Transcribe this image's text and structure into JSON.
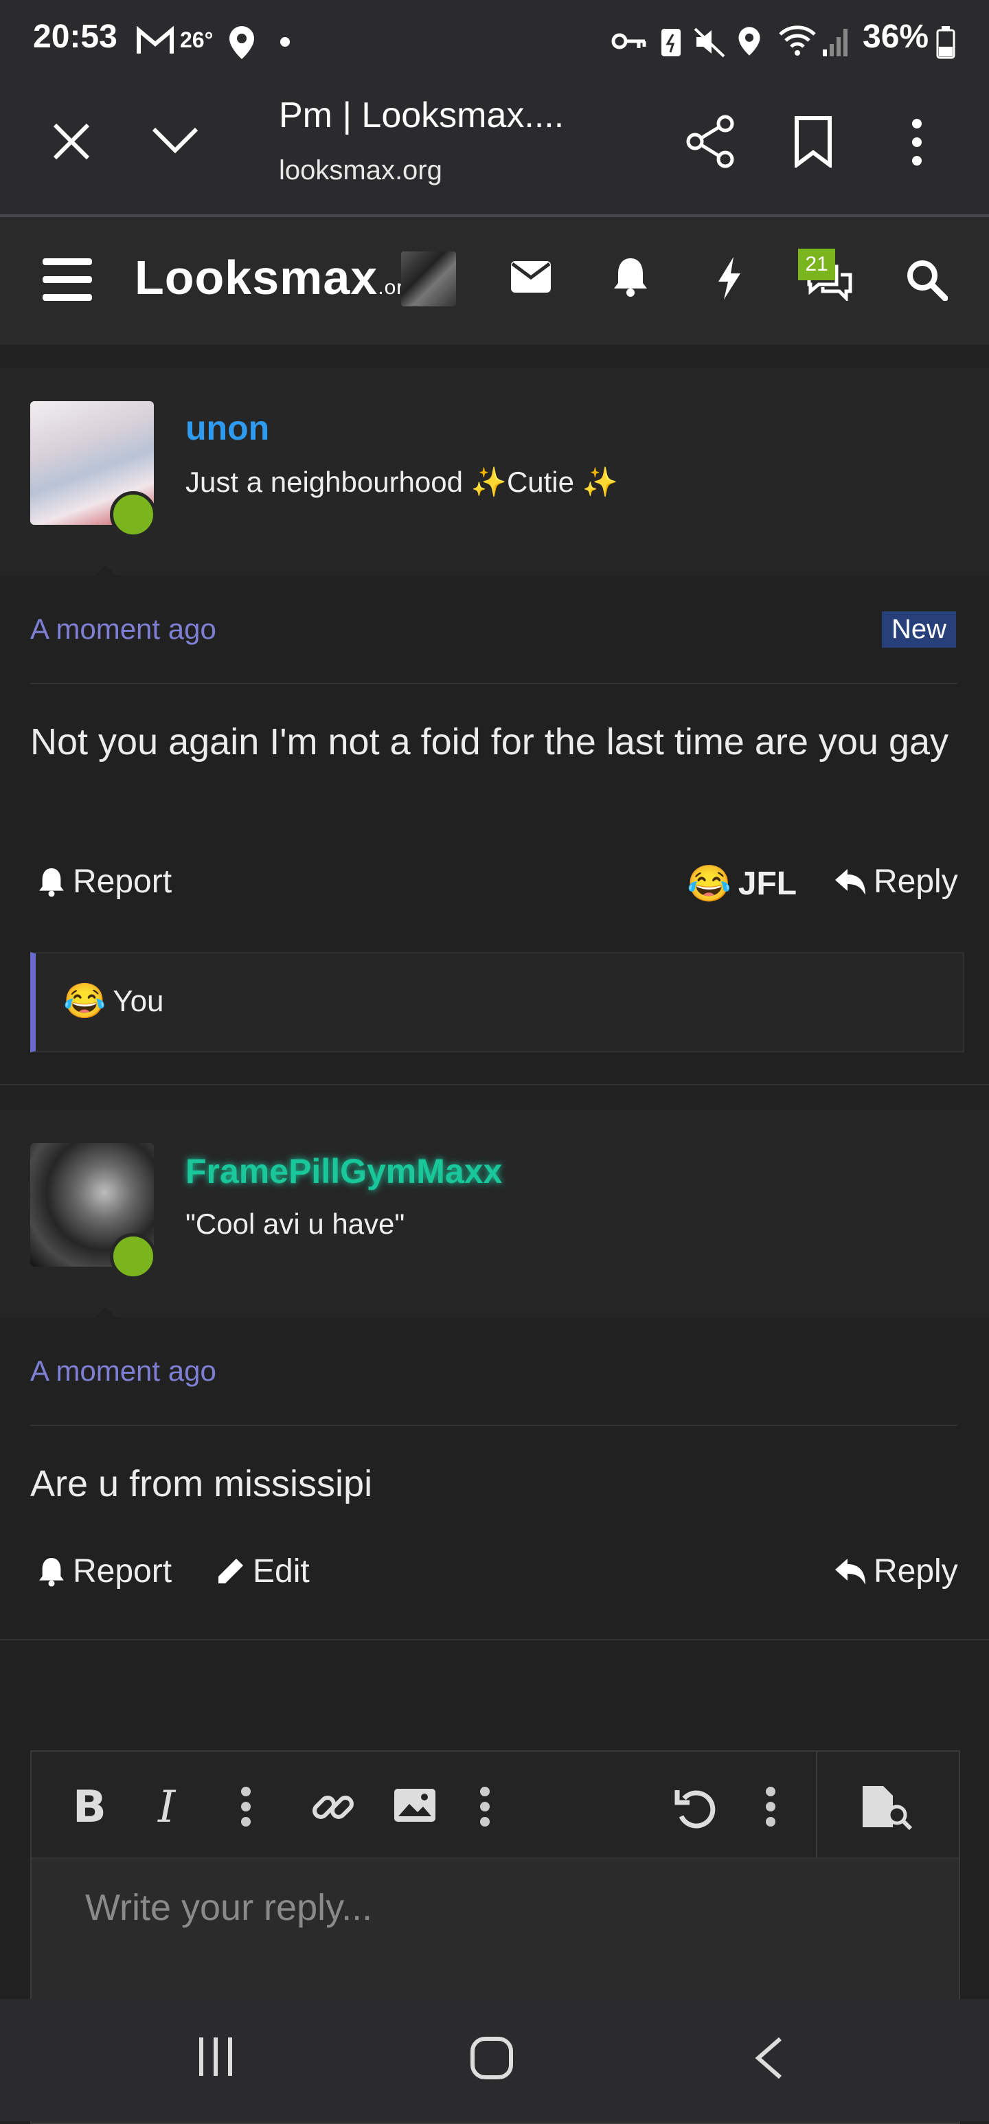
{
  "status": {
    "time": "20:53",
    "temperature": "26°",
    "battery": "36%"
  },
  "browser": {
    "page_title": "Pm | Looksmax....",
    "url": "looksmax.org"
  },
  "site": {
    "logo_main": "Looksmax",
    "logo_suffix": ".org",
    "conversations_badge": "21"
  },
  "posts": [
    {
      "username": "unon",
      "user_title": "Just a neighbourhood ✨Cutie ✨",
      "timestamp": "A moment ago",
      "new_label": "New",
      "message": "Not you again I'm not a foid for the last time are you gay",
      "report_label": "Report",
      "reaction_label": "JFL",
      "reply_label": "Reply",
      "reaction_summary": "You"
    },
    {
      "username": "FramePillGymMaxx",
      "user_title": "\"Cool avi u have\"",
      "timestamp": "A moment ago",
      "message": "Are u from mississipi",
      "report_label": "Report",
      "edit_label": "Edit",
      "reply_label": "Reply"
    }
  ],
  "editor": {
    "placeholder": "Write your reply..."
  },
  "colors": {
    "username_blue": "#2f9bf0",
    "username_teal": "#19c79a",
    "timestamp": "#7f7fd5",
    "online": "#7ab51d",
    "accent_bar": "#6a6acc"
  }
}
